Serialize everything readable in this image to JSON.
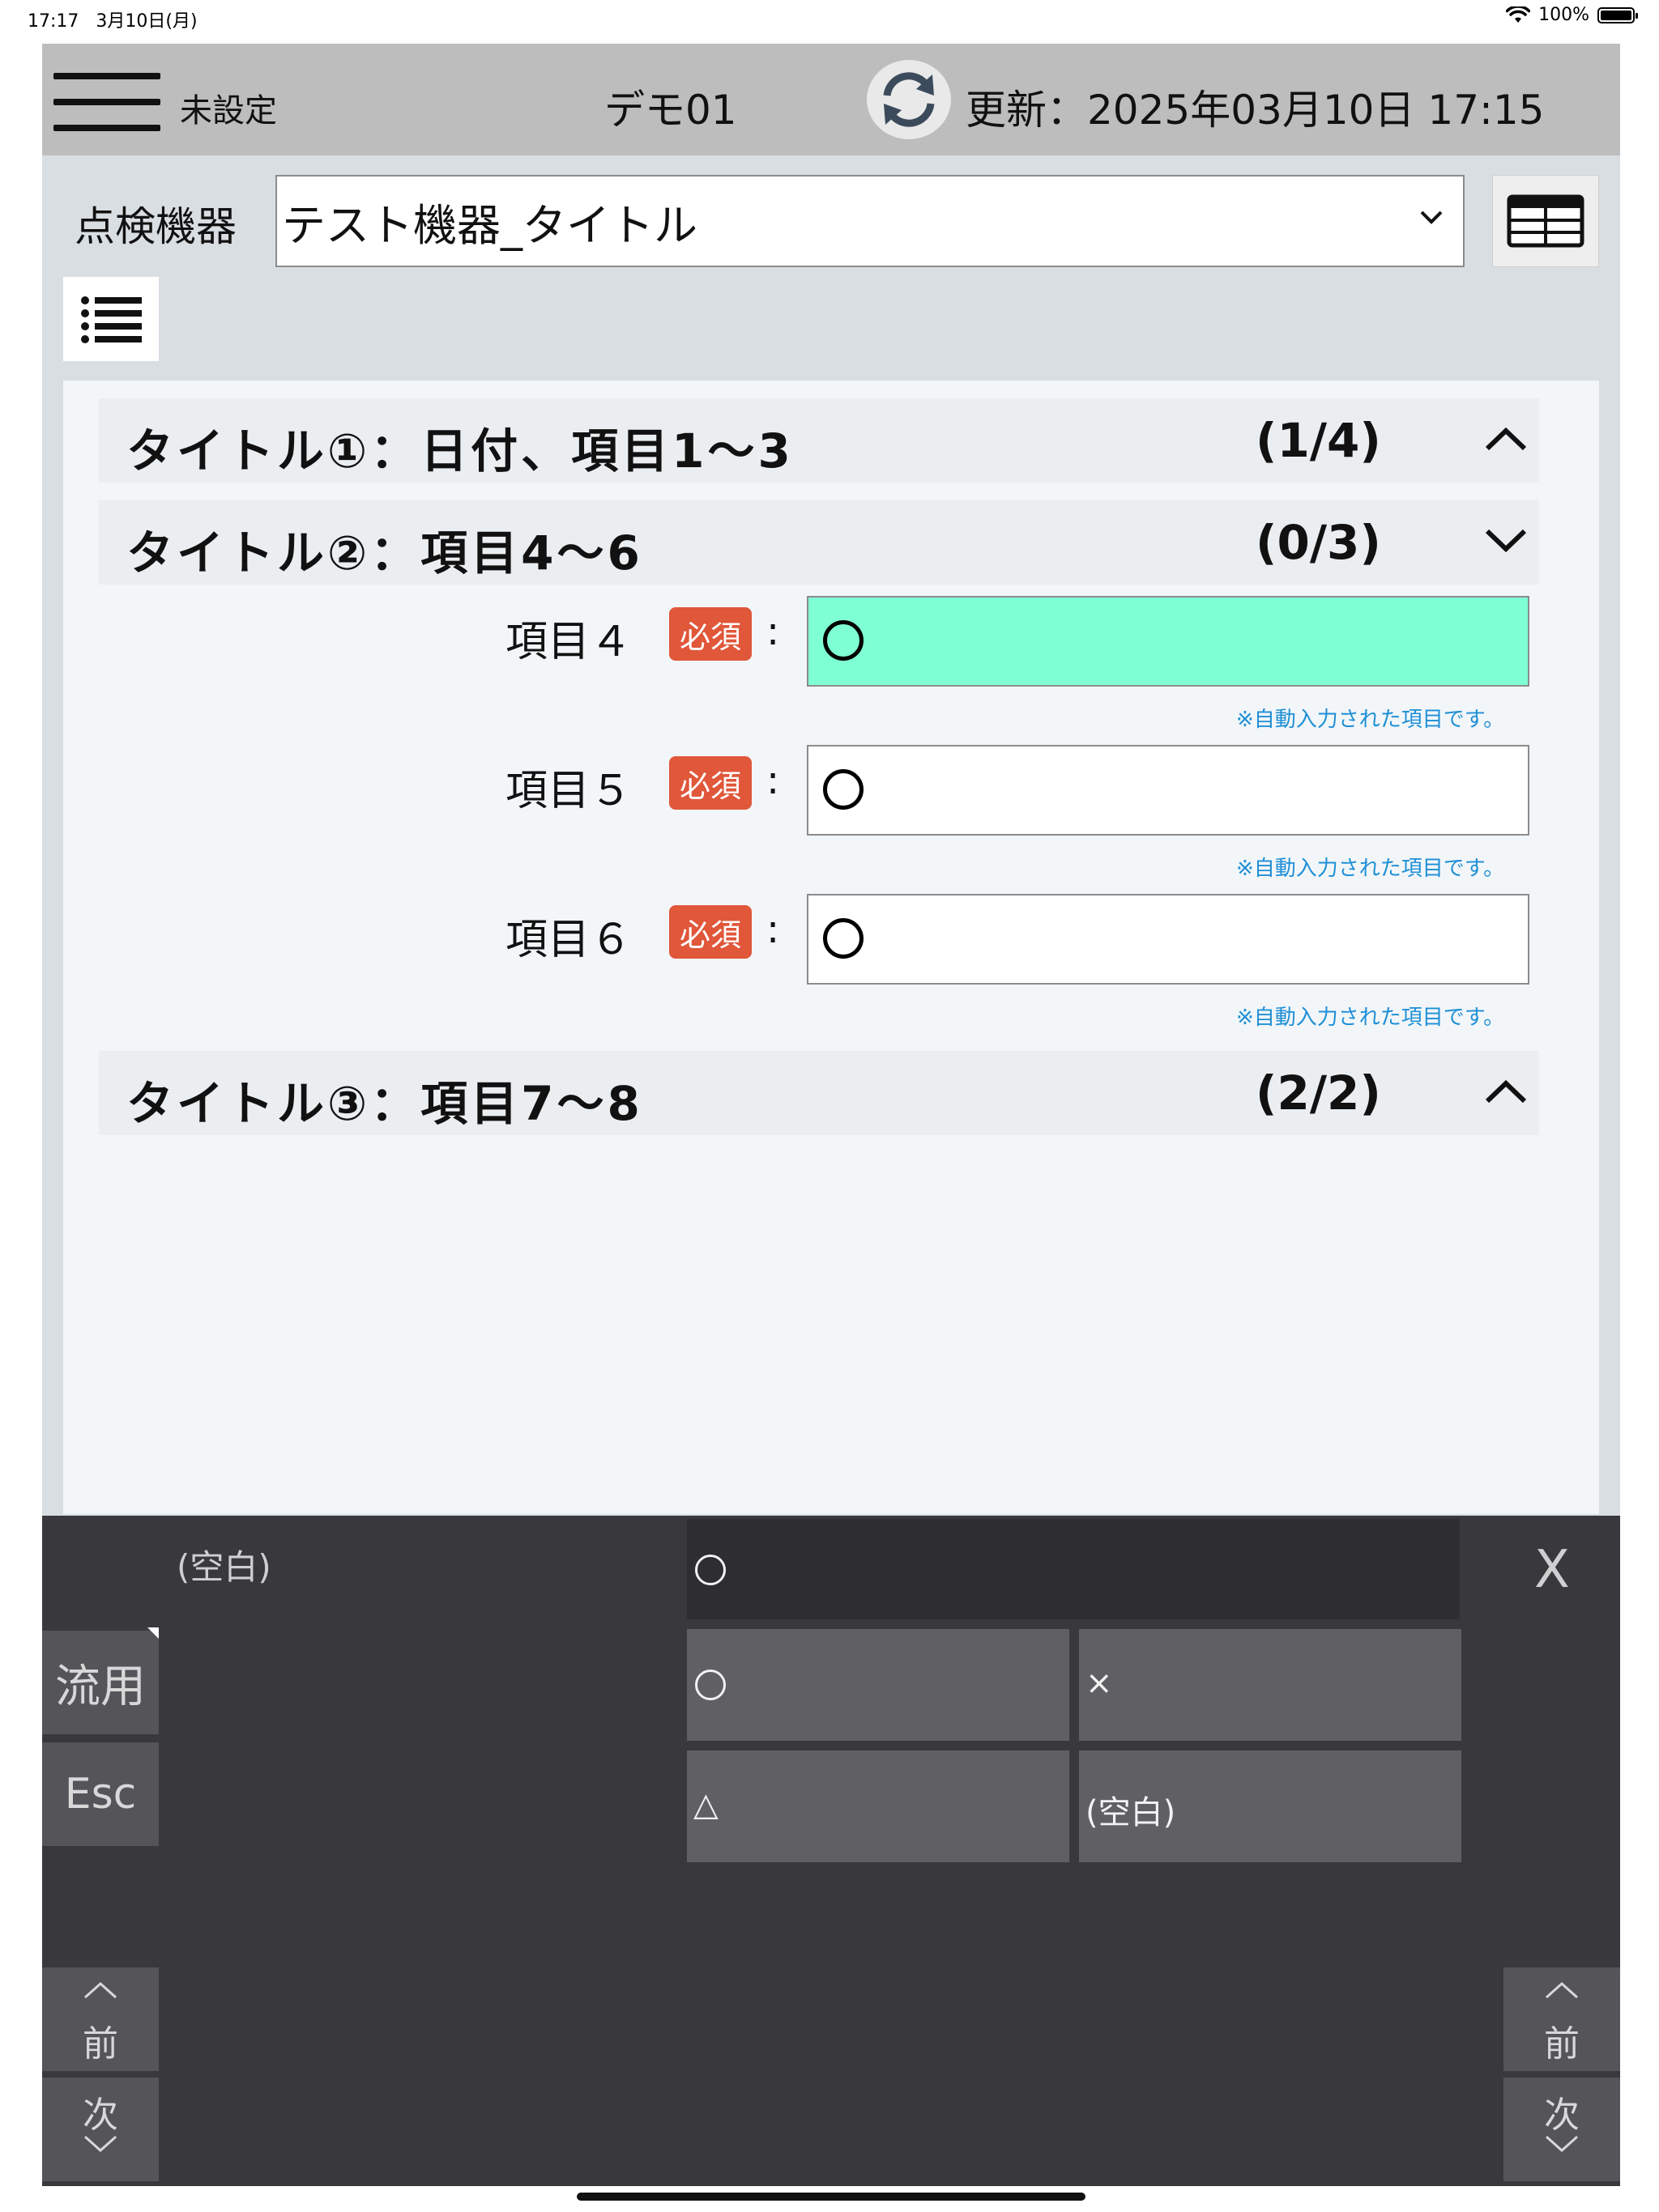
{
  "status_bar": {
    "time": "17:17",
    "date": "3月10日(月)",
    "battery": "100%"
  },
  "header": {
    "location": "未設定",
    "device": "デモ01",
    "updated": "更新：2025年03月10日 17:15"
  },
  "equipment": {
    "label": "点検機器",
    "selected": "テスト機器_タイトル"
  },
  "sections": [
    {
      "title": "タイトル①：日付、項目1～3",
      "count": "(1/4)"
    },
    {
      "title": "タイトル②：項目4～6",
      "count": "(0/3)"
    },
    {
      "title": "タイトル③：項目7～8",
      "count": "(2/2)"
    }
  ],
  "items": [
    {
      "label": "項目４",
      "required": "必須",
      "colon": ":",
      "note": "※自動入力された項目です。"
    },
    {
      "label": "項目５",
      "required": "必須",
      "colon": ":",
      "note": "※自動入力された項目です。"
    },
    {
      "label": "項目６",
      "required": "必須",
      "colon": ":",
      "note": "※自動入力された項目です。"
    }
  ],
  "input_panel": {
    "blank_label": "(空白)",
    "close_label": "X",
    "side_buttons": {
      "reuse": "流用",
      "esc": "Esc"
    },
    "options": [
      {
        "label": "○"
      },
      {
        "label": "×"
      },
      {
        "label": "△"
      },
      {
        "label": "(空白)"
      }
    ],
    "nav": {
      "prev": "前",
      "next": "次"
    }
  }
}
